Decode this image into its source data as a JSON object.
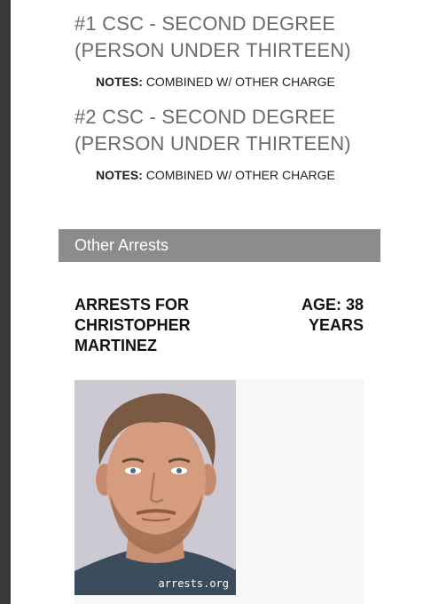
{
  "charges": [
    {
      "number": "#1",
      "title_line1": "#1 CSC - SECOND DEGREE",
      "title_line2": "(PERSON UNDER THIRTEEN)",
      "notes_label": "NOTES:",
      "notes_value": "COMBINED W/ OTHER CHARGE"
    },
    {
      "number": "#2",
      "title_line1": "#2 CSC - SECOND DEGREE",
      "title_line2": "(PERSON UNDER THIRTEEN)",
      "notes_label": "NOTES:",
      "notes_value": "COMBINED W/ OTHER CHARGE"
    }
  ],
  "other_arrests": {
    "section_label": "Other Arrests",
    "heading": "ARRESTS FOR CHRISTOPHER MARTINEZ",
    "age": "AGE: 38 YEARS"
  },
  "photo": {
    "watermark": "arrests.org"
  },
  "colors": {
    "section_bar": "#8c8c8c",
    "title_gray": "#6b6b6b",
    "left_bar": "#3a3a3a"
  }
}
